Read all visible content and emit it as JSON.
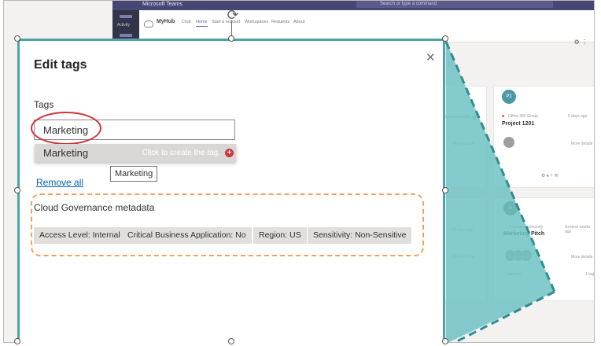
{
  "teams": {
    "app_title": "Microsoft Teams",
    "search_placeholder": "Search or type a command",
    "rail_label": "Activity"
  },
  "myhub": {
    "title": "MyHub",
    "nav": [
      {
        "label": "Chat"
      },
      {
        "label": "Home"
      },
      {
        "label": "Start a request"
      },
      {
        "label": "Workspaces"
      },
      {
        "label": "Requests"
      },
      {
        "label": "About"
      }
    ],
    "toolbar_icons": "⚙ ⋮"
  },
  "background_cards": {
    "card1": {
      "initials": "P1",
      "source": "Office 365 Group",
      "time": "5 days ago",
      "name": "Project 1201",
      "details": "More details"
    },
    "card2": {
      "initials": "M",
      "source": "Yammer community",
      "time": "Several weeks ago",
      "name": "Marketing Pitch",
      "details": "More details",
      "foot_left": "Yammer",
      "foot_right": "1 tag"
    },
    "left_fragments": {
      "top_time": "Several weeks ago",
      "top_details": "More details",
      "bottom_time": "17 days ago",
      "bottom_details": "More details"
    }
  },
  "dialog": {
    "title": "Edit tags",
    "close_glyph": "✕",
    "tags_label": "Tags",
    "input_value": "Marketing",
    "suggestion": {
      "label": "Marketing",
      "hint": "Click to create the tag.",
      "plus_glyph": "+"
    },
    "tooltip": "Marketing",
    "remove_all": "Remove all",
    "metadata_label": "Cloud Governance metadata",
    "metadata_chips": [
      {
        "label": "Access Level: Internal"
      },
      {
        "label": "Critical Business Application: No"
      },
      {
        "label": "Region: US"
      },
      {
        "label": "Sensitivity: Non-Sensitive"
      }
    ],
    "rotate_glyph": "⟳"
  },
  "colors": {
    "teal_overlay": "#6fc2c4",
    "teal_border": "#2e8d90",
    "highlight_red": "#d13438",
    "highlight_orange": "#f2a35a",
    "teams_purple": "#464775"
  }
}
